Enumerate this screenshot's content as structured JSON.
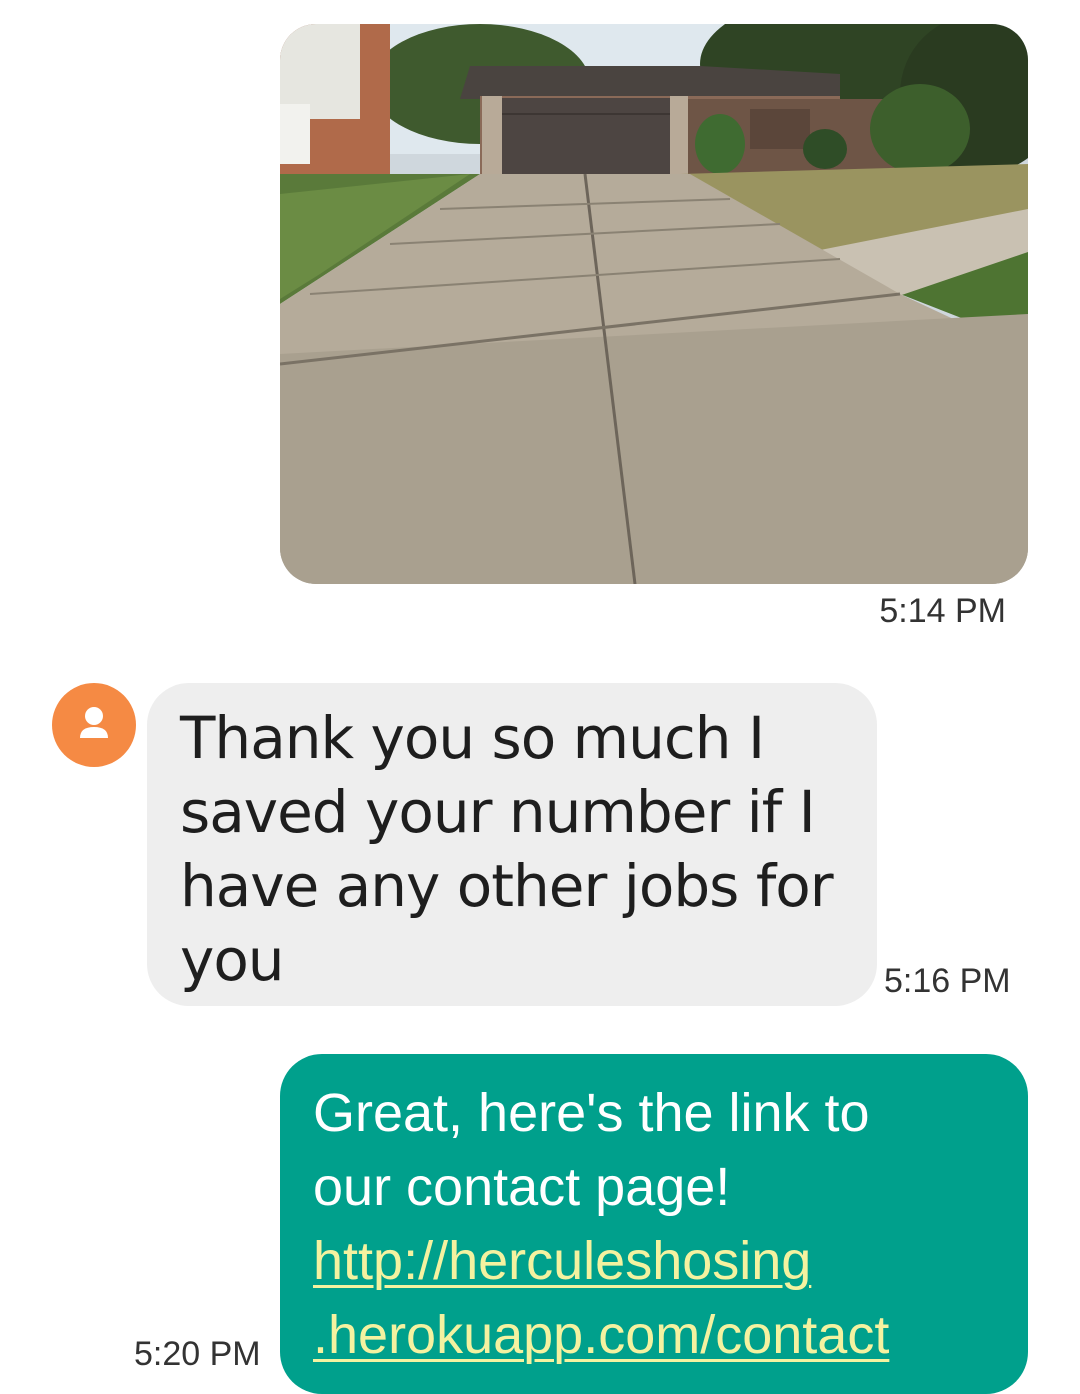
{
  "conversation": {
    "photo_message": {
      "time": "5:14 PM",
      "image_description_icon": "driveway-photo"
    },
    "incoming_message": {
      "lines": [
        "Thank you so much I",
        "saved your number if I",
        "have any other jobs for",
        "you"
      ],
      "time": "5:16 PM",
      "avatar_icon": "person-icon",
      "avatar_color": "#f58a44"
    },
    "outgoing_message": {
      "lines": [
        "Great, here's the link to",
        "our contact page!"
      ],
      "link_lines": [
        "http://herculeshosing",
        ".herokuapp.com/contact"
      ],
      "time": "5:20 PM",
      "bubble_color": "#00a08c",
      "link_color": "#f4f2a0"
    }
  }
}
